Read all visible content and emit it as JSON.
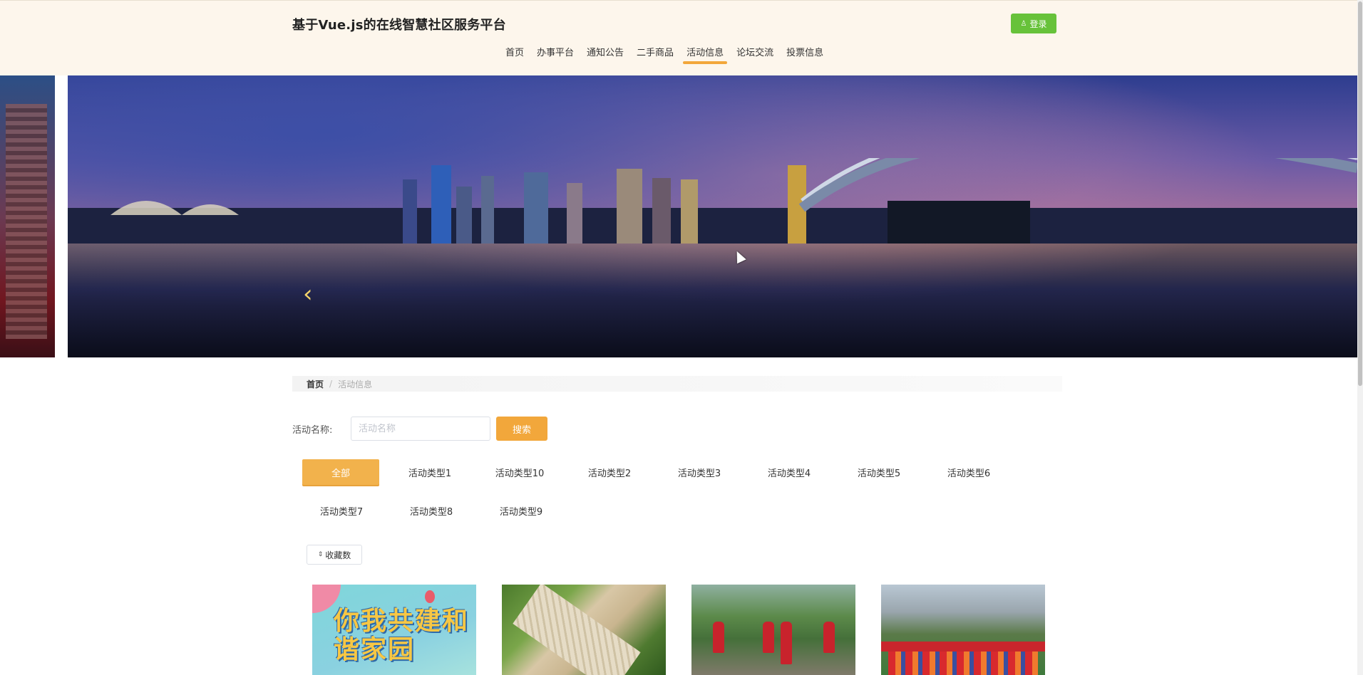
{
  "header": {
    "site_title": "基于Vue.js的在线智慧社区服务平台",
    "login_label": "登录",
    "login_icon": "user-icon",
    "background": "#fdf6ec",
    "nav": [
      {
        "label": "首页",
        "active": false
      },
      {
        "label": "办事平台",
        "active": false
      },
      {
        "label": "通知公告",
        "active": false
      },
      {
        "label": "二手商品",
        "active": false
      },
      {
        "label": "活动信息",
        "active": true
      },
      {
        "label": "论坛交流",
        "active": false
      },
      {
        "label": "投票信息",
        "active": false
      }
    ]
  },
  "banner": {
    "prev_arrow": "‹"
  },
  "breadcrumb": {
    "home": "首页",
    "separator": "/",
    "current": "活动信息"
  },
  "search": {
    "label": "活动名称:",
    "placeholder": "活动名称",
    "value": "",
    "button_label": "搜索"
  },
  "categories": [
    {
      "label": "全部",
      "active": true
    },
    {
      "label": "活动类型1",
      "active": false
    },
    {
      "label": "活动类型10",
      "active": false
    },
    {
      "label": "活动类型2",
      "active": false
    },
    {
      "label": "活动类型3",
      "active": false
    },
    {
      "label": "活动类型4",
      "active": false
    },
    {
      "label": "活动类型5",
      "active": false
    },
    {
      "label": "活动类型6",
      "active": false
    },
    {
      "label": "活动类型7",
      "active": false
    },
    {
      "label": "活动类型8",
      "active": false
    },
    {
      "label": "活动类型9",
      "active": false
    }
  ],
  "sort": {
    "label": "收藏数",
    "icon": "sort-icon"
  },
  "cards": [
    {
      "poster_text": "你我共建和谐家园"
    },
    {},
    {},
    {}
  ],
  "colors": {
    "accent": "#f2a73b",
    "login_green": "#67c23a"
  }
}
